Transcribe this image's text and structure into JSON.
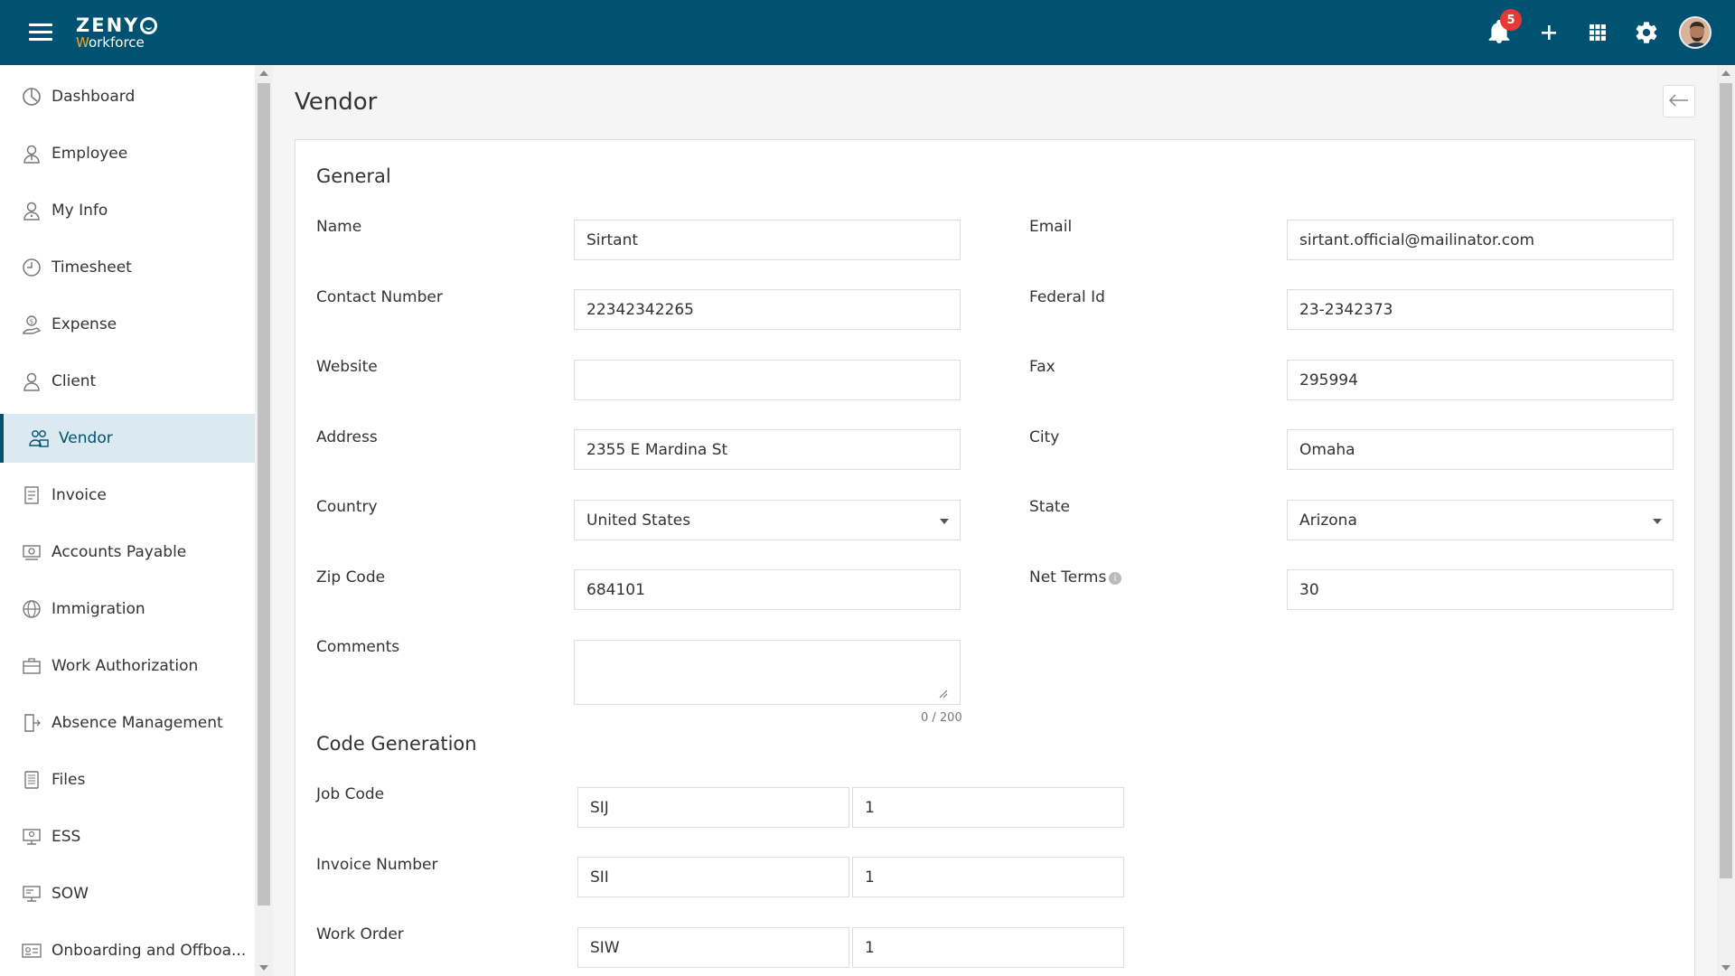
{
  "app": {
    "logo_main": "ZENY",
    "logo_sub_accent": "W",
    "logo_sub_rest": "orkforce",
    "notification_count": "5"
  },
  "sidebar": {
    "items": [
      {
        "label": "Dashboard",
        "icon": "dashboard-icon"
      },
      {
        "label": "Employee",
        "icon": "employee-icon"
      },
      {
        "label": "My Info",
        "icon": "my-info-icon"
      },
      {
        "label": "Timesheet",
        "icon": "clock-icon"
      },
      {
        "label": "Expense",
        "icon": "expense-icon"
      },
      {
        "label": "Client",
        "icon": "client-icon"
      },
      {
        "label": "Vendor",
        "icon": "vendor-icon",
        "active": true
      },
      {
        "label": "Invoice",
        "icon": "invoice-icon"
      },
      {
        "label": "Accounts Payable",
        "icon": "accounts-payable-icon"
      },
      {
        "label": "Immigration",
        "icon": "globe-icon"
      },
      {
        "label": "Work Authorization",
        "icon": "briefcase-icon"
      },
      {
        "label": "Absence Management",
        "icon": "exit-door-icon"
      },
      {
        "label": "Files",
        "icon": "files-icon"
      },
      {
        "label": "ESS",
        "icon": "ess-icon"
      },
      {
        "label": "SOW",
        "icon": "sow-icon"
      },
      {
        "label": "Onboarding and Offboa...",
        "icon": "id-card-icon"
      }
    ]
  },
  "page": {
    "title": "Vendor"
  },
  "general": {
    "title": "General",
    "name_label": "Name",
    "name_value": "Sirtant",
    "email_label": "Email",
    "email_value": "sirtant.official@mailinator.com",
    "contact_label": "Contact Number",
    "contact_value": "22342342265",
    "federal_label": "Federal Id",
    "federal_value": "23-2342373",
    "website_label": "Website",
    "website_value": "",
    "fax_label": "Fax",
    "fax_value": "295994",
    "address_label": "Address",
    "address_value": "2355 E Mardina St",
    "city_label": "City",
    "city_value": "Omaha",
    "country_label": "Country",
    "country_value": "United States",
    "state_label": "State",
    "state_value": "Arizona",
    "zip_label": "Zip Code",
    "zip_value": "684101",
    "netterms_label": "Net Terms",
    "netterms_value": "30",
    "comments_label": "Comments",
    "comments_value": "",
    "comments_counter": "0 / 200"
  },
  "code_generation": {
    "title": "Code Generation",
    "job_label": "Job Code",
    "job_prefix": "SIJ",
    "job_start": "1",
    "invoice_label": "Invoice Number",
    "invoice_prefix": "SII",
    "invoice_start": "1",
    "workorder_label": "Work Order",
    "workorder_prefix": "SIW",
    "workorder_start": "1"
  },
  "colors": {
    "topbar": "#005273",
    "active_item_bg": "#dbe9f0",
    "badge": "#e53935",
    "logo_accent": "#f5a623"
  }
}
